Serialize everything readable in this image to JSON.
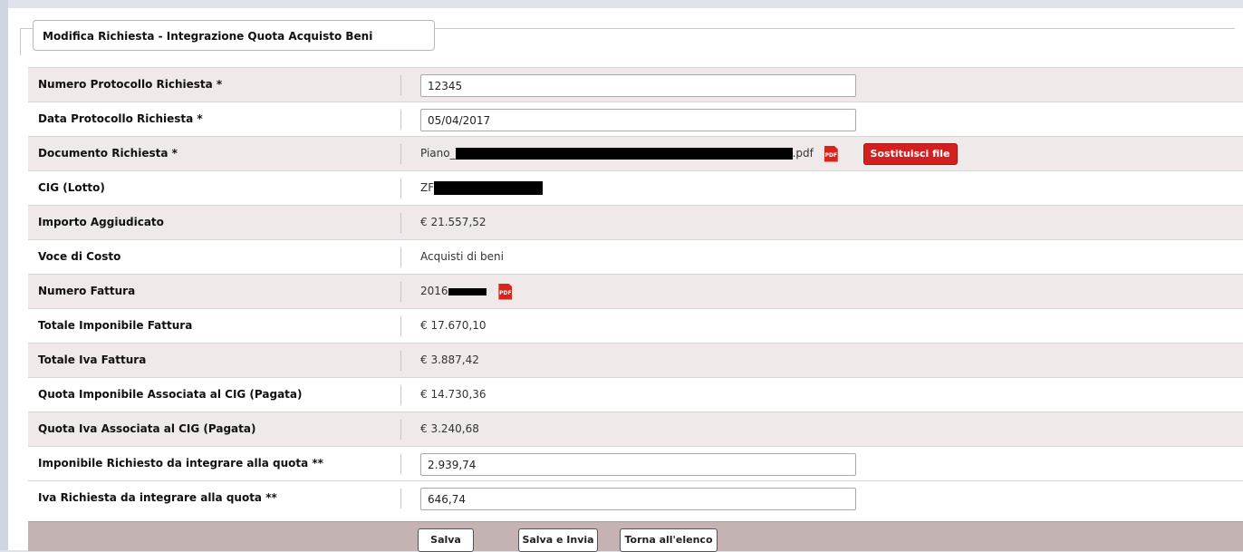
{
  "form": {
    "title": "Modifica Richiesta - Integrazione Quota Acquisto Beni"
  },
  "rows": {
    "numero_protocollo": {
      "label": "Numero Protocollo Richiesta *",
      "value": "12345"
    },
    "data_protocollo": {
      "label": "Data Protocollo Richiesta *",
      "value": "05/04/2017"
    },
    "documento": {
      "label": "Documento Richiesta *",
      "file_prefix": "Piano_",
      "file_suffix": ".pdf",
      "pdf_icon_text": "PDF",
      "replace_button": "Sostituisci file"
    },
    "cig": {
      "label": "CIG (Lotto)",
      "value_prefix": "ZF"
    },
    "importo": {
      "label": "Importo Aggiudicato",
      "value": "€ 21.557,52"
    },
    "voce_costo": {
      "label": "Voce di Costo",
      "value": "Acquisti di beni"
    },
    "numero_fattura": {
      "label": "Numero Fattura",
      "value_prefix": "2016",
      "pdf_icon_text": "PDF"
    },
    "totale_imponibile": {
      "label": "Totale Imponibile Fattura",
      "value": "€ 17.670,10"
    },
    "totale_iva": {
      "label": "Totale Iva Fattura",
      "value": "€ 3.887,42"
    },
    "quota_imponibile": {
      "label": "Quota Imponibile Associata al CIG (Pagata)",
      "value": "€ 14.730,36"
    },
    "quota_iva": {
      "label": "Quota Iva Associata al CIG (Pagata)",
      "value": "€ 3.240,68"
    },
    "imponibile_richiesto": {
      "label": "Imponibile Richiesto da integrare alla quota **",
      "value": "2.939,74"
    },
    "iva_richiesta": {
      "label": "Iva Richiesta da integrare alla quota **",
      "value": "646,74"
    }
  },
  "footer": {
    "save": "Salva",
    "save_send": "Salva e Invia",
    "back": "Torna all'elenco"
  },
  "colors": {
    "alt_row": "#efe9ea",
    "footer": "#c5b3b3",
    "accent_red": "#d21f1f"
  }
}
